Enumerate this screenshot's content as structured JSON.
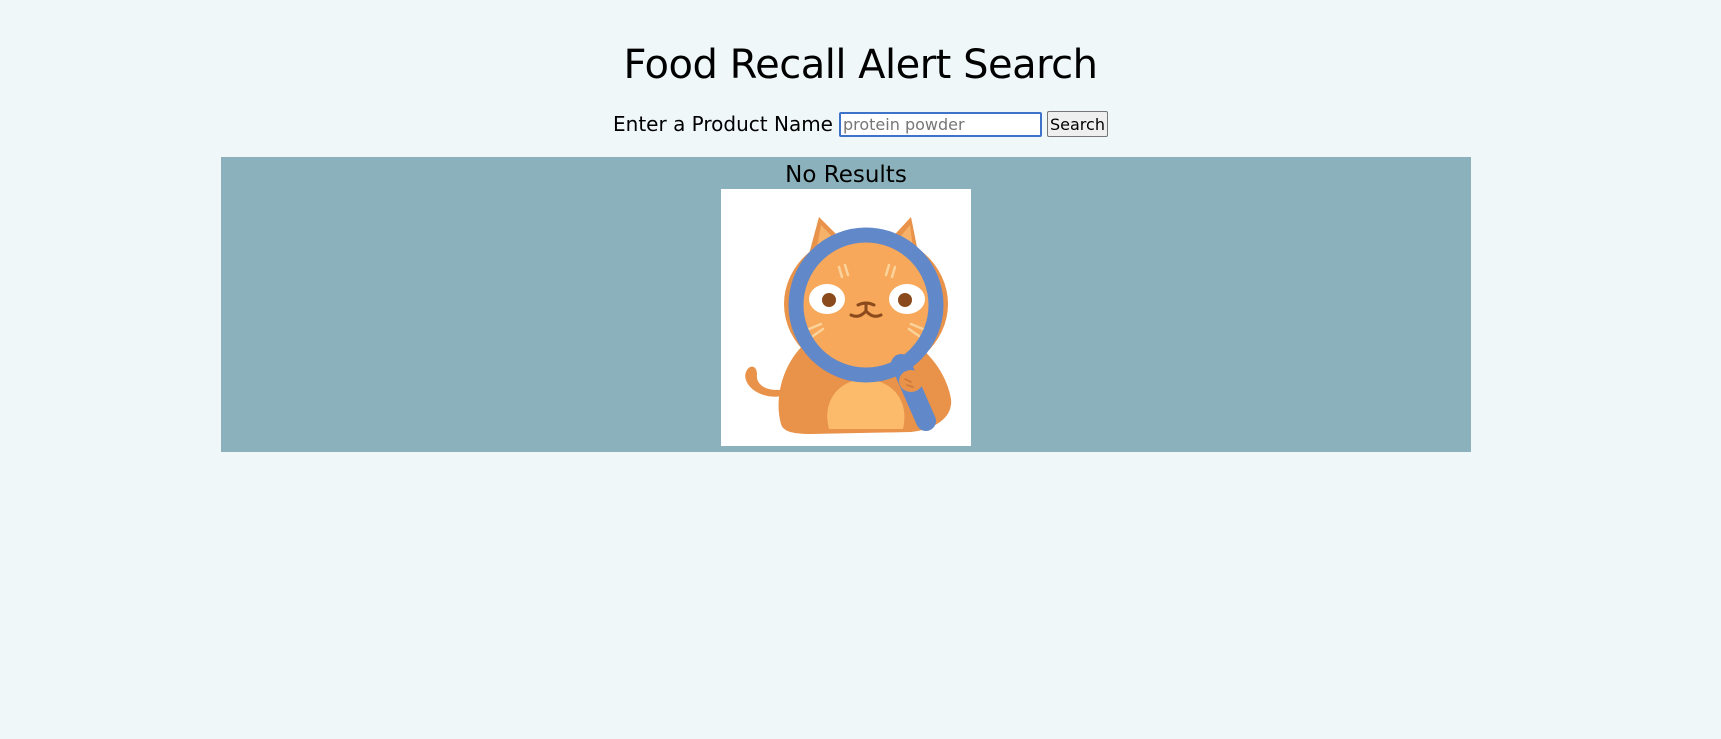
{
  "page": {
    "title": "Food Recall Alert Search"
  },
  "search": {
    "label": "Enter a Product Name",
    "placeholder": "protein powder",
    "value": "",
    "button_label": "Search"
  },
  "results": {
    "heading": "No Results",
    "illustration": "cat-with-magnifying-glass-icon"
  },
  "colors": {
    "background": "#eff7f9",
    "results_panel": "#8bb2bc",
    "input_focus_border": "#3f73c9",
    "cat_orange": "#f5a55a",
    "magnifier_blue": "#6188c8"
  }
}
